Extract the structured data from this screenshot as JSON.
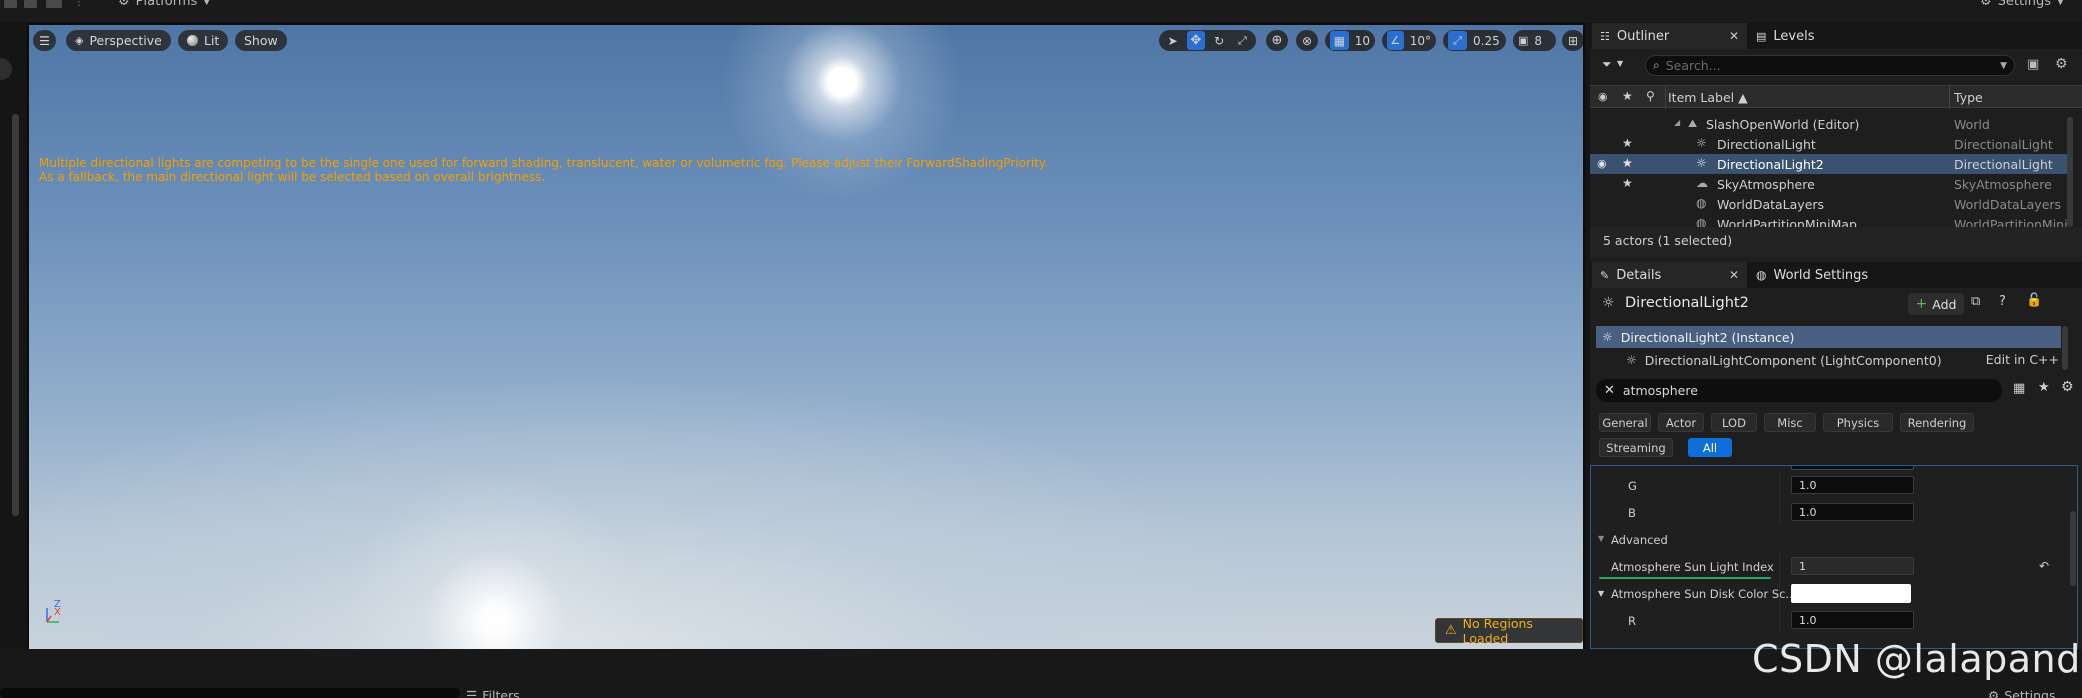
{
  "app": {
    "platforms_label": "Platforms",
    "settings_label": "Settings"
  },
  "viewport": {
    "perspective_label": "Perspective",
    "lit_label": "Lit",
    "show_label": "Show",
    "grid_snap": "10",
    "rotation_snap": "10°",
    "scale_snap": "0.25",
    "camera_speed": "8",
    "warning_line1": "Multiple directional lights are competing to be the single one used for forward shading, translucent, water or volumetric fog. Please adjust their ForwardShadingPriority.",
    "warning_line2": "As a fallback, the main directional light will be selected based on overall brightness.",
    "no_regions": "No Regions Loaded",
    "axis_z": "Z",
    "axis_x": "X"
  },
  "outliner": {
    "tab_label": "Outliner",
    "levels_tab_label": "Levels",
    "search_placeholder": "Search...",
    "col_label": "Item Label ▲",
    "col_type": "Type",
    "rows": [
      {
        "label": "SlashOpenWorld (Editor)",
        "type": "World"
      },
      {
        "label": "DirectionalLight",
        "type": "DirectionalLight"
      },
      {
        "label": "DirectionalLight2",
        "type": "DirectionalLight"
      },
      {
        "label": "SkyAtmosphere",
        "type": "SkyAtmosphere"
      },
      {
        "label": "WorldDataLayers",
        "type": "WorldDataLayers"
      },
      {
        "label": "WorldPartitionMiniMap",
        "type": "WorldPartitionMiniI"
      }
    ],
    "count_text": "5 actors (1 selected)"
  },
  "details": {
    "tab_label": "Details",
    "world_settings_tab_label": "World Settings",
    "actor_name": "DirectionalLight2",
    "add_label": "Add",
    "instance_label": "DirectionalLight2 (Instance)",
    "component_label": "DirectionalLightComponent (LightComponent0)",
    "edit_cpp": "Edit in C++",
    "search_value": "atmosphere",
    "categories": [
      "General",
      "Actor",
      "LOD",
      "Misc",
      "Physics",
      "Rendering",
      "Streaming",
      "All"
    ],
    "props": {
      "g_label": "G",
      "g_value": "1.0",
      "b_label": "B",
      "b_value": "1.0",
      "advanced_label": "Advanced",
      "sun_index_label": "Atmosphere Sun Light Index",
      "sun_index_value": "1",
      "disk_color_label": "Atmosphere Sun Disk Color Sc...",
      "r_label": "R",
      "r_value": "1.0"
    }
  },
  "bottom": {
    "filters_label": "Filters",
    "settings_label": "Settings",
    "watermark": "CSDN @lalapanda"
  }
}
